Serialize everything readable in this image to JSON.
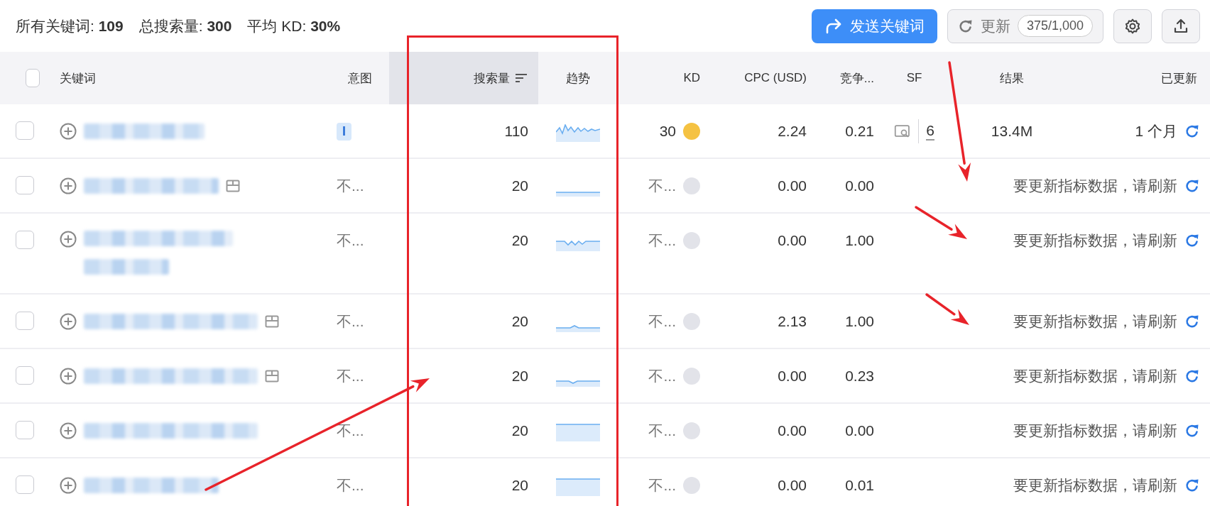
{
  "stats": [
    "所有关键词: **109**",
    "总搜索量: **300**",
    "平均 KD: **30%**"
  ],
  "toolbar": {
    "send_button": "发送关键词",
    "update_button": "更新",
    "quota": "375/1,000"
  },
  "table": {
    "select_all": {
      "checked": false
    },
    "columns": [
      {
        "label": "关键词",
        "sorted": false
      },
      {
        "label": "意图",
        "sorted": false
      },
      {
        "label": "搜索量",
        "sorted": true
      },
      {
        "label": "趋势",
        "sorted": false
      },
      {
        "label": "KD",
        "sorted": false
      },
      {
        "label": "CPC (USD)",
        "sorted": false
      },
      {
        "label": "竞争...",
        "sorted": false
      },
      {
        "label": "SF",
        "sorted": false
      },
      {
        "label": "结果",
        "sorted": false
      },
      {
        "label": "已更新",
        "sorted": false
      }
    ],
    "rows": [
      {
        "kind": "fresh",
        "checked": false,
        "keyword": {
          "kind": "short",
          "page_icon": false
        },
        "intent": {
          "kind": "badge",
          "text": "I"
        },
        "volume": "110",
        "trend": {
          "kind": "wavy"
        },
        "kd": {
          "text": "30",
          "color": "#f5c242"
        },
        "cpc": "2.24",
        "competition": "0.21",
        "sf_count": "6",
        "results": "13.4M",
        "updated": "1 个月"
      },
      {
        "kind": "stale",
        "checked": false,
        "keyword": {
          "kind": "medium",
          "page_icon": true
        },
        "intent": {
          "kind": "text",
          "text": "不..."
        },
        "volume": "20",
        "trend": {
          "kind": "flat"
        },
        "kd": {
          "text": "不...",
          "color": "#e2e3e9"
        },
        "cpc": "0.00",
        "competition": "0.00",
        "message": "要更新指标数据，请刷新"
      },
      {
        "kind": "stale",
        "checked": false,
        "keyword": {
          "kind": "wrapped",
          "page_icon": false
        },
        "intent": {
          "kind": "text",
          "text": "不..."
        },
        "volume": "20",
        "trend": {
          "kind": "zigzag"
        },
        "kd": {
          "text": "不...",
          "color": "#e2e3e9"
        },
        "cpc": "0.00",
        "competition": "1.00",
        "message": "要更新指标数据，请刷新"
      },
      {
        "kind": "stale",
        "checked": false,
        "keyword": {
          "kind": "long",
          "page_icon": true
        },
        "intent": {
          "kind": "text",
          "text": "不..."
        },
        "volume": "20",
        "trend": {
          "kind": "bump"
        },
        "kd": {
          "text": "不...",
          "color": "#e2e3e9"
        },
        "cpc": "2.13",
        "competition": "1.00",
        "message": "要更新指标数据，请刷新"
      },
      {
        "kind": "stale",
        "checked": false,
        "keyword": {
          "kind": "long",
          "page_icon": true
        },
        "intent": {
          "kind": "text",
          "text": "不..."
        },
        "volume": "20",
        "trend": {
          "kind": "dip"
        },
        "kd": {
          "text": "不...",
          "color": "#e2e3e9"
        },
        "cpc": "0.00",
        "competition": "0.23",
        "message": "要更新指标数据，请刷新"
      },
      {
        "kind": "stale",
        "checked": false,
        "keyword": {
          "kind": "long",
          "page_icon": false
        },
        "intent": {
          "kind": "text",
          "text": "不..."
        },
        "volume": "20",
        "trend": {
          "kind": "block"
        },
        "kd": {
          "text": "不...",
          "color": "#e2e3e9"
        },
        "cpc": "0.00",
        "competition": "0.00",
        "message": "要更新指标数据，请刷新"
      },
      {
        "kind": "stale",
        "checked": false,
        "keyword": {
          "kind": "medium",
          "page_icon": false
        },
        "intent": {
          "kind": "text",
          "text": "不..."
        },
        "volume": "20",
        "trend": {
          "kind": "block"
        },
        "kd": {
          "text": "不...",
          "color": "#e2e3e9"
        },
        "cpc": "0.00",
        "competition": "0.01",
        "message": "要更新指标数据，请刷新"
      }
    ]
  }
}
